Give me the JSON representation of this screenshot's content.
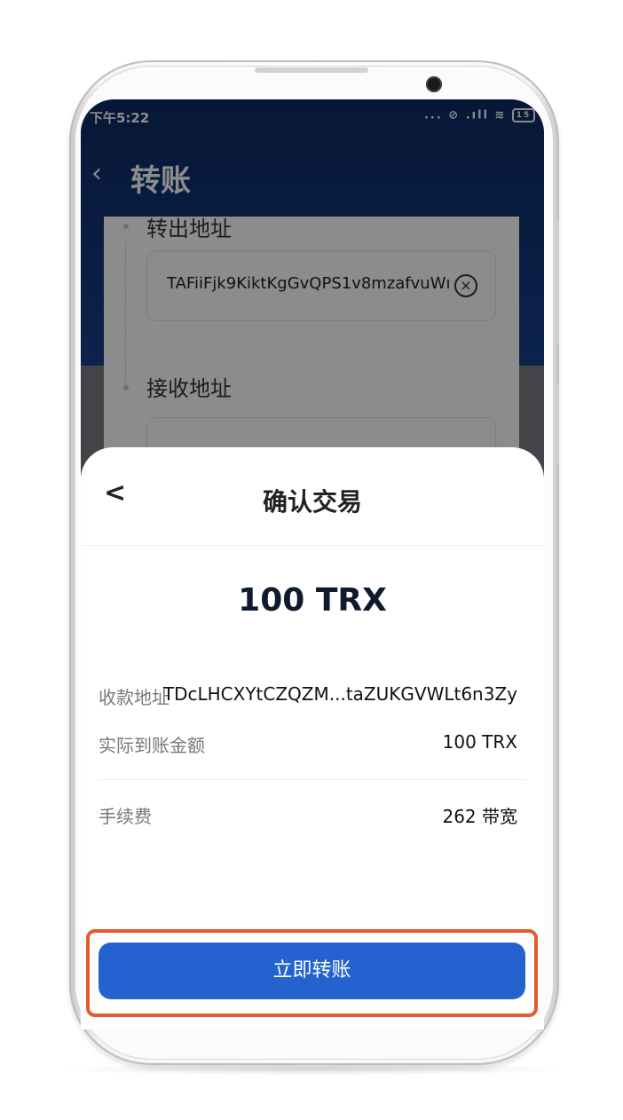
{
  "status_bar": {
    "time": "下午5:22",
    "icons": "... ⊘ .ıll ≋",
    "battery": "15"
  },
  "app": {
    "title": "转账",
    "back_icon": "chevron-left-icon",
    "from": {
      "label": "转出地址",
      "value": "TAFiiFjk9KiktKgGvQPS1v8mzafvuWı"
    },
    "to": {
      "label": "接收地址"
    }
  },
  "sheet": {
    "title": "确认交易",
    "amount": "100 TRX",
    "rows": [
      {
        "label": "收款地址",
        "value": "TDcLHCXYtCZQZM...taZUKGVWLt6n3Zy"
      },
      {
        "label": "实际到账金额",
        "value": "100 TRX"
      },
      {
        "label": "手续费",
        "value": "262 带宽"
      }
    ],
    "confirm_button": "立即转账"
  },
  "colors": {
    "header_bg": "#16408a",
    "button_bg": "#2463cf",
    "highlight": "#e35a2b"
  }
}
